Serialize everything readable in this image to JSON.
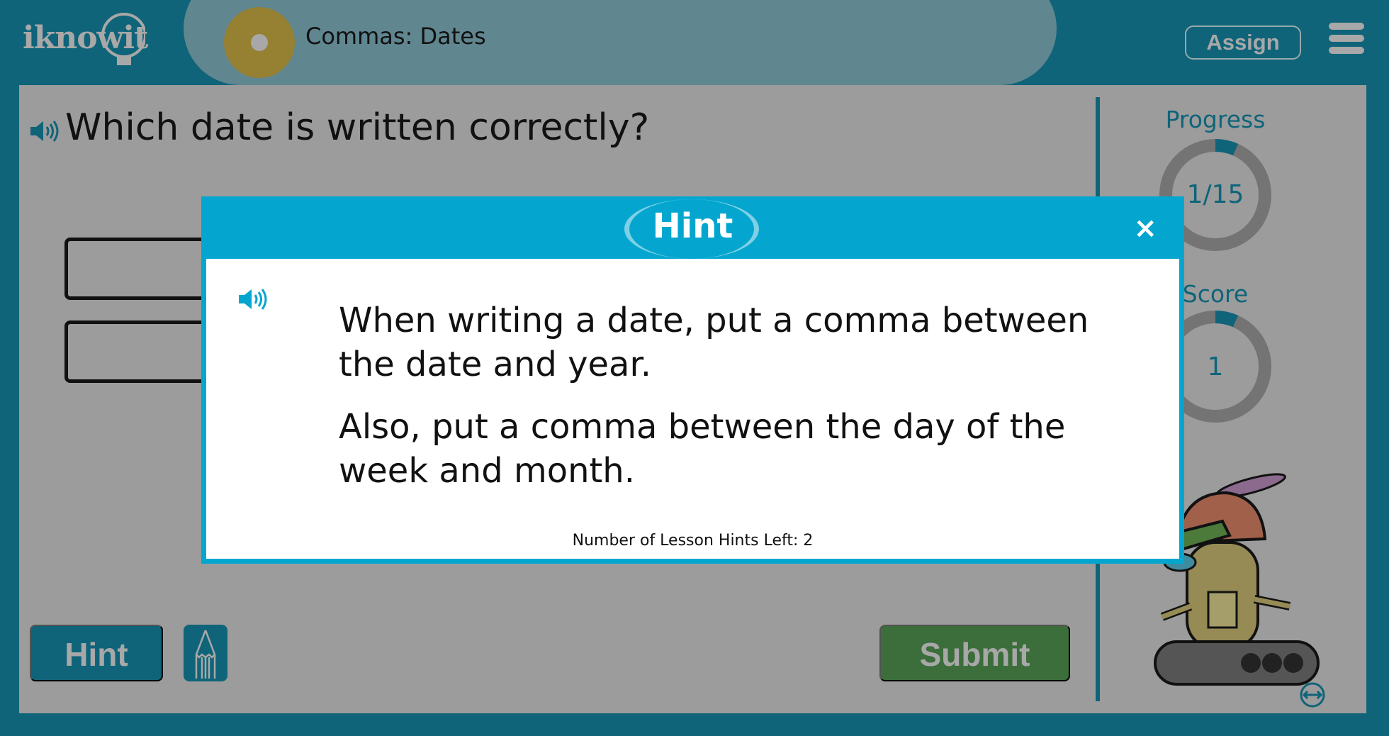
{
  "header": {
    "logo": "iknowit",
    "lesson_title": "Commas: Dates",
    "assign_label": "Assign",
    "menu_icon": "hamburger-icon"
  },
  "question": {
    "text": "Which date is written correctly?"
  },
  "sidebar": {
    "progress_label": "Progress",
    "progress_value": "1/15",
    "progress_fraction": 0.0667,
    "score_label": "Score",
    "score_value": "1",
    "accent": "#0f6479"
  },
  "footer": {
    "hint_label": "Hint",
    "submit_label": "Submit"
  },
  "modal": {
    "title": "Hint",
    "close": "×",
    "paragraphs": [
      "When writing a date, put a comma between the date and year.",
      "Also, put a comma between the day of the week and month."
    ],
    "hints_left": "Number of Lesson Hints Left: 2",
    "color": "#04a6cf"
  }
}
